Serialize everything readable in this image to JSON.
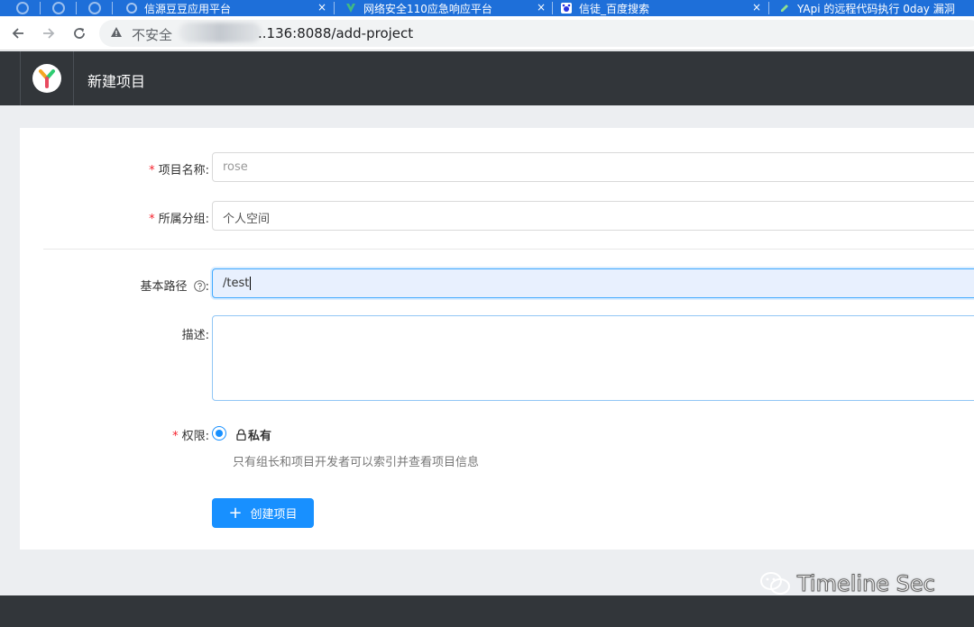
{
  "browser": {
    "tabs": [
      {
        "title": "信源豆豆应用平台"
      },
      {
        "title": "网络安全110应急响应平台"
      },
      {
        "title": "信徒_百度搜索"
      },
      {
        "title": "YApi 的远程代码执行 0day 漏洞"
      }
    ],
    "tab_close_glyph": "×",
    "security_label": "不安全",
    "url": "..136:8088/add-project"
  },
  "app": {
    "title": "新建项目"
  },
  "form": {
    "project_name_label": "项目名称:",
    "project_name_value": "rose",
    "group_label": "所属分组:",
    "group_value": "个人空间",
    "base_path_label": "基本路径",
    "base_path_suffix": ":",
    "base_path_value": "/test",
    "description_label": "描述:",
    "description_value": "",
    "permission_label": "权限:",
    "permission_option": "私有",
    "permission_hint": "只有组长和项目开发者可以索引并查看项目信息",
    "submit_label": "创建项目",
    "required_mark": "*"
  },
  "watermark": {
    "text": "Timeline Sec"
  },
  "colors": {
    "tabstrip": "#1e6fd9",
    "header": "#32363a",
    "primary": "#1890ff",
    "required": "#f5222d"
  }
}
